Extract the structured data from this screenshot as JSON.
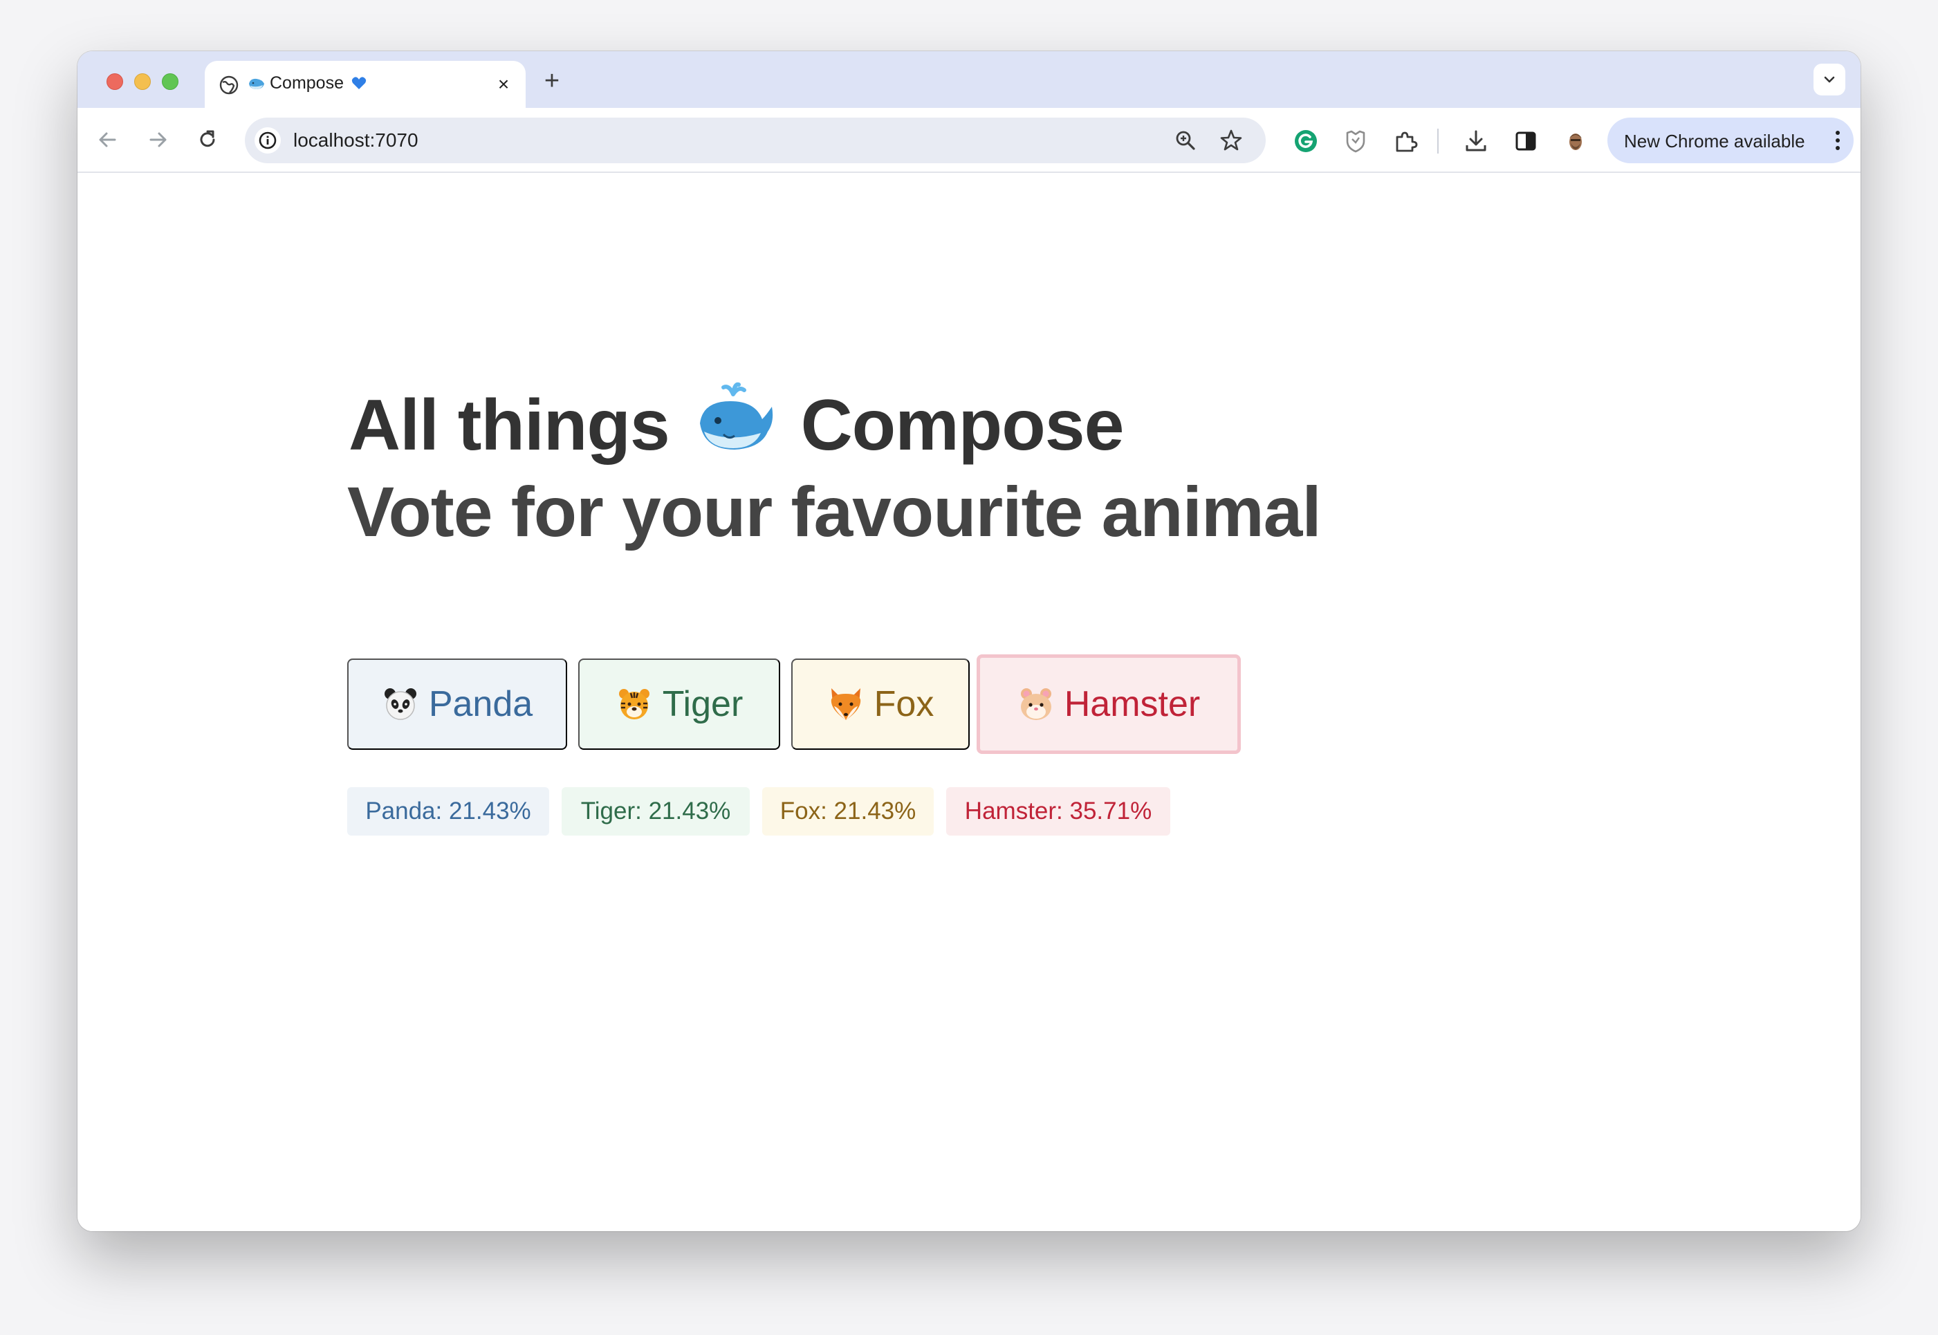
{
  "browser": {
    "tab_title": "Compose",
    "tab_title_suffix_icon": "blue-heart-icon",
    "tab_prefix_icon": "whale-icon",
    "new_tab_label": "+",
    "close_tab_label": "×",
    "url": "localhost:7070",
    "update_label": "New Chrome available"
  },
  "page": {
    "title_before": "All things",
    "title_after": "Compose",
    "title_icon": "whale-icon",
    "subtitle": "Vote for your favourite animal"
  },
  "vote_buttons": [
    {
      "icon": "panda-icon",
      "label": "Panda",
      "color": "#3a6a9c",
      "background": "#eef3f8"
    },
    {
      "icon": "tiger-icon",
      "label": "Tiger",
      "color": "#2f6c4a",
      "background": "#eef8f1"
    },
    {
      "icon": "fox-icon",
      "label": "Fox",
      "color": "#8c6418",
      "background": "#fdf8e8"
    },
    {
      "icon": "hamster-icon",
      "label": "Hamster",
      "color": "#c02338",
      "background": "#fbeced",
      "selected": true
    }
  ],
  "results": [
    {
      "label": "Panda: 21.43%"
    },
    {
      "label": "Tiger: 21.43%"
    },
    {
      "label": "Fox: 21.43%"
    },
    {
      "label": "Hamster: 35.71%"
    }
  ]
}
